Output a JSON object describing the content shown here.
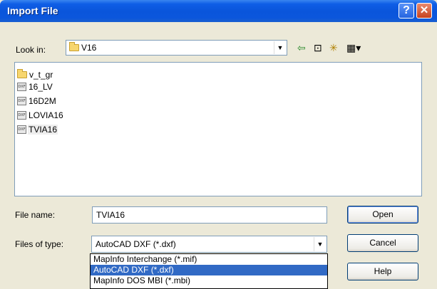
{
  "window": {
    "title": "Import File",
    "help_glyph": "?",
    "close_glyph": "✕"
  },
  "lookin": {
    "label": "Look in:",
    "value": "V16",
    "toolbar": {
      "back_glyph": "⇦",
      "up_glyph": "⊡",
      "newfolder_glyph": "✳",
      "views_glyph": "▦▾"
    }
  },
  "files": [
    {
      "name": "v_t_gr",
      "type": "folder"
    },
    {
      "name": "16_LV",
      "type": "dxf"
    },
    {
      "name": "16D2M",
      "type": "dxf"
    },
    {
      "name": "LOVIA16",
      "type": "dxf"
    },
    {
      "name": "TVIA16",
      "type": "dxf",
      "selected": true
    }
  ],
  "filename": {
    "label": "File name:",
    "value": "TVIA16"
  },
  "filetype": {
    "label": "Files of type:",
    "value": "AutoCAD DXF (*.dxf)",
    "options": [
      "MapInfo Interchange (*.mif)",
      "AutoCAD DXF (*.dxf)",
      "MapInfo DOS MBI (*.mbi)"
    ],
    "highlighted_index": 1
  },
  "buttons": {
    "open": "Open",
    "cancel": "Cancel",
    "help": "Help"
  },
  "icon_labels": {
    "dxf": "DXF"
  }
}
